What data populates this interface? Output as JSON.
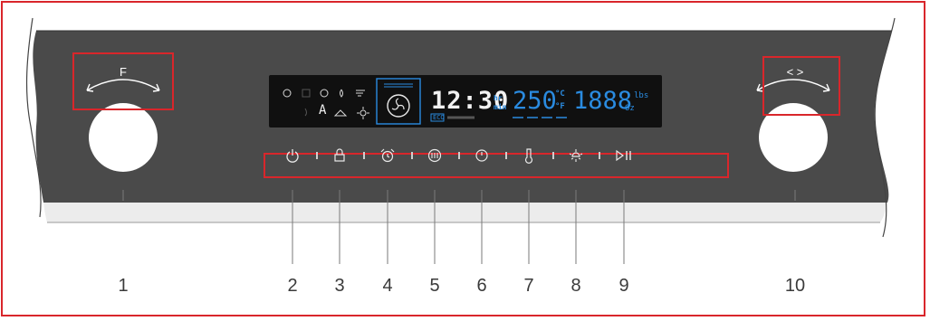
{
  "knobs": [
    {
      "id": "1",
      "label": "F"
    },
    {
      "id": "10",
      "label": "< >"
    }
  ],
  "display": {
    "time": "12:30",
    "time_unit_hr": "hr",
    "time_unit_min": "min",
    "temperature": "250",
    "temp_unit_c": "°C",
    "temp_unit_f": "°F",
    "weight": "1888",
    "weight_unit_lbs": "lbs",
    "weight_unit_oz": "Oz",
    "eco_tag": "ECO",
    "mode_letter": "A"
  },
  "buttons": [
    {
      "number": "2",
      "icon": "power-icon"
    },
    {
      "number": "3",
      "icon": "lock-icon"
    },
    {
      "number": "4",
      "icon": "alarm-icon"
    },
    {
      "number": "5",
      "icon": "fast-preheat-icon"
    },
    {
      "number": "6",
      "icon": "timer-icon"
    },
    {
      "number": "7",
      "icon": "thermometer-icon"
    },
    {
      "number": "8",
      "icon": "light-icon"
    },
    {
      "number": "9",
      "icon": "play-pause-icon"
    }
  ],
  "callouts": [
    "1",
    "2",
    "3",
    "4",
    "5",
    "6",
    "7",
    "8",
    "9",
    "10"
  ],
  "colors": {
    "panel": "#4a4a4a",
    "lcd": "#111111",
    "segment_white": "#f2f2f2",
    "segment_blue": "#2a8be0",
    "annotation_red": "#d9262b"
  }
}
